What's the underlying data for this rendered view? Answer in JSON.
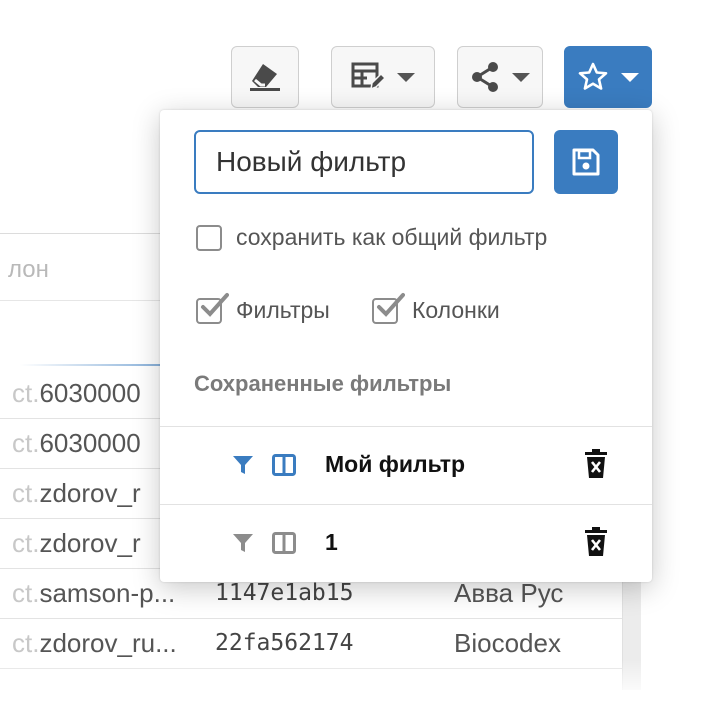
{
  "table": {
    "column_header": "лон",
    "rows": [
      {
        "a_prefix": "ct.",
        "a_main": "6030000",
        "b": "",
        "c": ""
      },
      {
        "a_prefix": "ct.",
        "a_main": "6030000",
        "b": "",
        "c": ""
      },
      {
        "a_prefix": "ct.",
        "a_main": "zdorov_r",
        "b": "",
        "c": ""
      },
      {
        "a_prefix": "ct.",
        "a_main": "zdorov_r",
        "b": "",
        "c": ""
      },
      {
        "a_prefix": "ct.",
        "a_main": "samson-p...",
        "b": "1147e1ab15",
        "c": "Авва Рус"
      },
      {
        "a_prefix": "ct.",
        "a_main": "zdorov_ru...",
        "b": "22fa562174",
        "c": "Biocodex"
      }
    ]
  },
  "toolbar": {
    "buttons": [
      {
        "name": "eraser-button",
        "icon": "eraser-icon"
      },
      {
        "name": "column-edit-button",
        "icon": "table-edit-icon"
      },
      {
        "name": "share-button",
        "icon": "share-icon"
      },
      {
        "name": "favorites-button",
        "icon": "star-icon"
      }
    ]
  },
  "popup": {
    "filter_name_value": "Новый фильтр",
    "filter_name_placeholder": "",
    "save_icon": "floppy-disk-icon",
    "share_checkbox_label": "сохранить как общий фильтр",
    "share_checked": false,
    "filters_checkbox_label": "Фильтры",
    "filters_checked": true,
    "columns_checkbox_label": "Колонки",
    "columns_checked": true,
    "saved_title": "Сохраненные фильтры",
    "saved_filters": [
      {
        "name": "Мой фильтр",
        "active": true
      },
      {
        "name": "1",
        "active": false
      }
    ]
  },
  "colors": {
    "accent": "#3a7cc0",
    "muted_icon": "#8c8c8c"
  }
}
